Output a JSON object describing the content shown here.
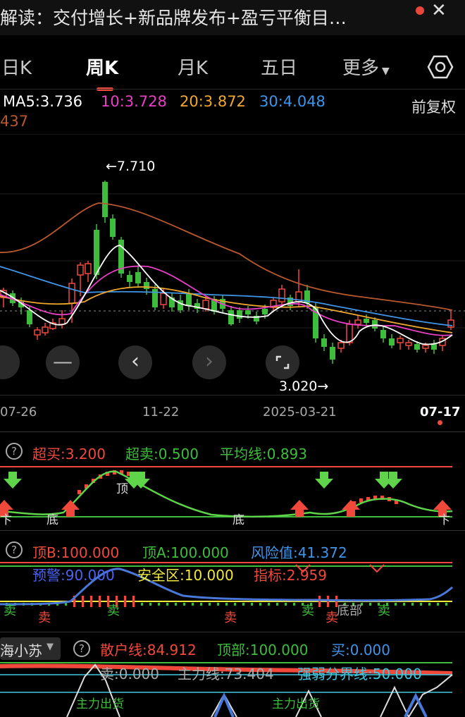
{
  "header": {
    "title": "解读：交付增长+新品牌发布+盈亏平衡目…",
    "close_glyph": "✕"
  },
  "tabs": [
    {
      "label": "日K"
    },
    {
      "label": "周K"
    },
    {
      "label": "月K"
    },
    {
      "label": "五日"
    },
    {
      "label": "更多"
    }
  ],
  "ma": {
    "ma5": "MA5:3.736",
    "ma10": "10:3.728",
    "ma20": "20:3.872",
    "ma30": "30:4.048",
    "ma_extra": "437",
    "adjust": "前复权"
  },
  "chart_annotations": {
    "high": "←7.710",
    "low": "3.020→"
  },
  "x_axis": [
    "07-26",
    "11-22",
    "2025-03-21",
    "07-17"
  ],
  "panel1": {
    "overbuy": "超买:3.200",
    "oversell": "超卖:0.500",
    "avg": "平均线:0.893",
    "top": "顶",
    "bottom1": "底",
    "bottom2": "底",
    "right_marker": "卞",
    "left_marker": "卞"
  },
  "panel2": {
    "topB": "顶B:100.000",
    "topA": "顶A:100.000",
    "risk": "风险值:41.372",
    "warn": "预警:90.000",
    "safe": "安全区:10.000",
    "index": "指标:2.959",
    "sells": [
      "卖",
      "卖",
      "卖",
      "卖",
      "卖",
      "卖",
      "卖"
    ],
    "bottom": "底部"
  },
  "panel3": {
    "selector": "海小苏",
    "retail": "散户线:84.912",
    "top": "顶部:100.000",
    "buy": "买:0.000",
    "sell": "卖:0.000",
    "main": "主力线:73.404",
    "divide": "强弱分界线:50.000",
    "outflow1": "主力出货",
    "outflow2": "主力出货"
  },
  "colors": {
    "up": "#f0493c",
    "down": "#3ebd3c",
    "ma5": "#ffffff",
    "ma10": "#e83fc6",
    "ma20": "#f0a92c",
    "ma30": "#3f95e8",
    "ma60": "#b8582e"
  },
  "chart_data": {
    "type": "candlestick",
    "annotations": [
      "←7.710",
      "3.020→"
    ],
    "x_ticks": [
      "07-26",
      "11-22",
      "2025-03-21",
      "07-17"
    ],
    "series_labels": [
      "MA5:3.736",
      "10:3.728",
      "20:3.872",
      "30:4.048"
    ]
  }
}
